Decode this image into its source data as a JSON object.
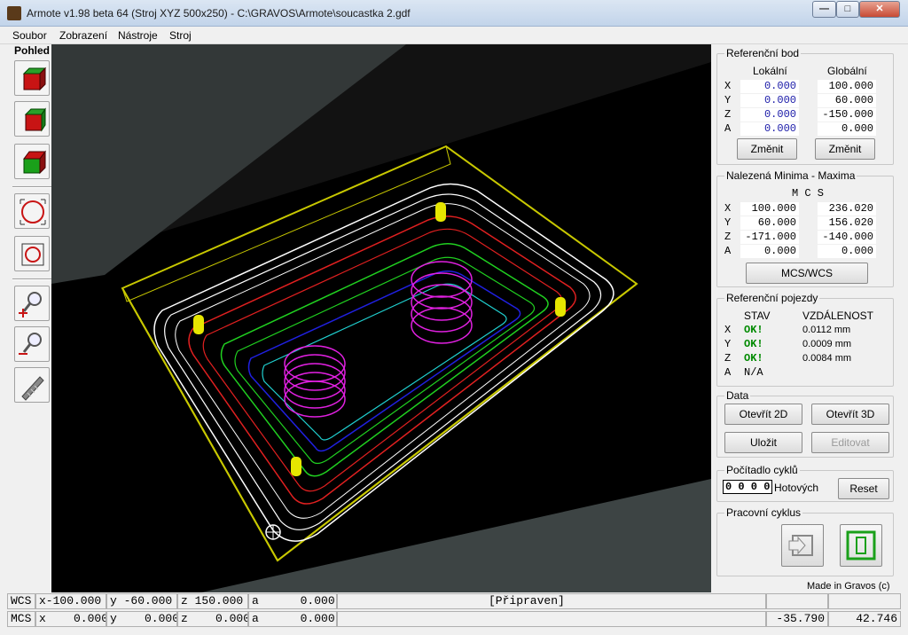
{
  "window": {
    "title": "Armote v1.98 beta 64 (Stroj XYZ 500x250) - C:\\GRAVOS\\Armote\\soucastka 2.gdf",
    "min": "—",
    "max": "□",
    "close": "✕"
  },
  "menu": [
    {
      "label": "Soubor"
    },
    {
      "label": "Zobrazení"
    },
    {
      "label": "Nástroje"
    },
    {
      "label": "Stroj"
    }
  ],
  "toolbar": {
    "title": "Pohled",
    "icons": [
      "cube-front-red-icon",
      "cube-side-red-icon",
      "cube-top-green-icon",
      "circle-view-icon",
      "circle-frame-view-icon",
      "zoom-in-icon",
      "zoom-out-icon",
      "tool-icon"
    ]
  },
  "ref": {
    "title": "Referenční bod",
    "col_local": "Lokální",
    "col_global": "Globální",
    "rows": [
      {
        "axis": "X",
        "local": "0.000",
        "global": "100.000"
      },
      {
        "axis": "Y",
        "local": "0.000",
        "global": "60.000"
      },
      {
        "axis": "Z",
        "local": "0.000",
        "global": "-150.000"
      },
      {
        "axis": "A",
        "local": "0.000",
        "global": "0.000"
      }
    ],
    "btn1": "Změnit",
    "btn2": "Změnit"
  },
  "minmax": {
    "title": "Nalezená Minima - Maxima",
    "header": "M C S",
    "rows": [
      {
        "axis": "X",
        "min": "100.000",
        "max": "236.020"
      },
      {
        "axis": "Y",
        "min": "60.000",
        "max": "156.020"
      },
      {
        "axis": "Z",
        "min": "-171.000",
        "max": "-140.000"
      },
      {
        "axis": "A",
        "min": "0.000",
        "max": "0.000"
      }
    ],
    "button": "MCS/WCS"
  },
  "refmoves": {
    "title": "Referenční pojezdy",
    "col_state": "STAV",
    "col_dist": "VZDÁLENOST",
    "rows": [
      {
        "axis": "X",
        "state": "OK!",
        "dist": "0.0112 mm"
      },
      {
        "axis": "Y",
        "state": "OK!",
        "dist": "0.0009 mm"
      },
      {
        "axis": "Z",
        "state": "OK!",
        "dist": "0.0084 mm"
      },
      {
        "axis": "A",
        "state": "N/A",
        "dist": ""
      }
    ]
  },
  "data": {
    "title": "Data",
    "open2d": "Otevřít 2D",
    "open3d": "Otevřít 3D",
    "save": "Uložit",
    "edit": "Editovat"
  },
  "counter": {
    "title": "Počítadlo cyklů",
    "value": "0 0 0 0",
    "label": "Hotových",
    "reset": "Reset"
  },
  "cycle": {
    "title": "Pracovní cyklus"
  },
  "credit": "Made in Gravos (c)",
  "status": {
    "wcs": {
      "label": "WCS",
      "x": "x-100.000",
      "y": "y -60.000",
      "z": "z 150.000",
      "a": "a      0.000",
      "msg": "[Připraven]"
    },
    "mcs": {
      "label": "MCS",
      "x": "x    0.000",
      "y": "y    0.000",
      "z": "z    0.000",
      "a": "a      0.000",
      "v1": "-35.790",
      "v2": "42.746"
    }
  },
  "colors": {
    "accent_red": "#c81414",
    "accent_green": "#1aa01a",
    "yellow": "#e6e600"
  }
}
